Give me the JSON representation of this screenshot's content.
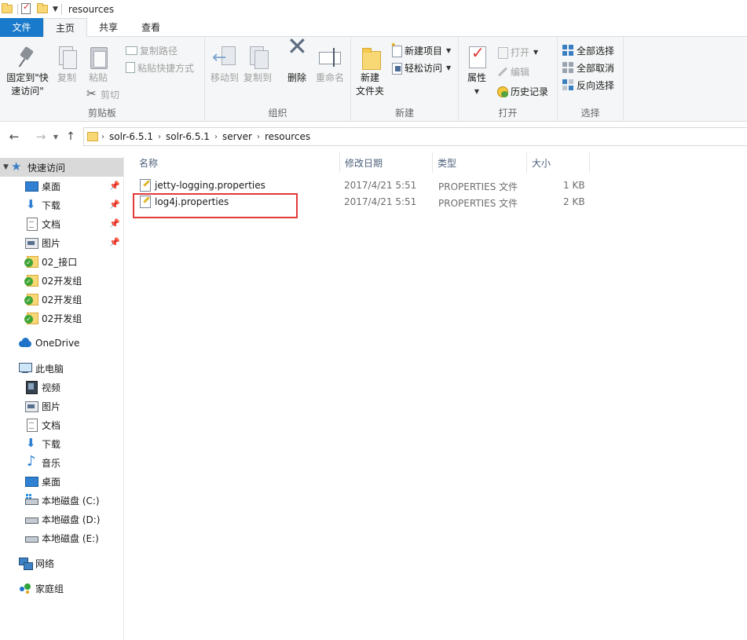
{
  "window": {
    "title": "resources"
  },
  "tabs": {
    "file": "文件",
    "home": "主页",
    "share": "共享",
    "view": "查看"
  },
  "ribbon": {
    "clipboard": {
      "pin_label": "固定到\"快速访问\"",
      "pin_line1": "固定到\"快",
      "pin_line2": "速访问\"",
      "copy": "复制",
      "paste": "粘贴",
      "copy_path": "复制路径",
      "paste_shortcut": "粘贴快捷方式",
      "cut": "剪切",
      "group": "剪贴板"
    },
    "organize": {
      "move_to": "移动到",
      "copy_to": "复制到",
      "delete": "删除",
      "rename": "重命名",
      "group": "组织"
    },
    "new": {
      "new_folder_line1": "新建",
      "new_folder_line2": "文件夹",
      "new_item": "新建项目",
      "easy_access": "轻松访问",
      "group": "新建"
    },
    "open": {
      "properties": "属性",
      "open": "打开",
      "edit": "编辑",
      "history": "历史记录",
      "group": "打开"
    },
    "select": {
      "select_all": "全部选择",
      "select_none": "全部取消",
      "invert": "反向选择",
      "group": "选择"
    }
  },
  "address": {
    "crumbs": [
      "solr-6.5.1",
      "solr-6.5.1",
      "server",
      "resources"
    ]
  },
  "sidebar": {
    "quick_access": "快速访问",
    "quick_items": [
      {
        "label": "桌面",
        "icon": "desktop-icon",
        "pinned": true
      },
      {
        "label": "下载",
        "icon": "download-icon",
        "pinned": true
      },
      {
        "label": "文档",
        "icon": "document-icon",
        "pinned": true
      },
      {
        "label": "图片",
        "icon": "picture-icon",
        "pinned": true
      },
      {
        "label": "02_接口",
        "icon": "sync-folder-icon",
        "pinned": false
      },
      {
        "label": "02开发组",
        "icon": "sync-folder-icon",
        "pinned": false
      },
      {
        "label": "02开发组",
        "icon": "sync-folder-icon",
        "pinned": false
      },
      {
        "label": "02开发组",
        "icon": "sync-folder-icon",
        "pinned": false
      }
    ],
    "onedrive": "OneDrive",
    "this_pc": "此电脑",
    "pc_items": [
      {
        "label": "视频",
        "icon": "video-icon"
      },
      {
        "label": "图片",
        "icon": "picture-icon"
      },
      {
        "label": "文档",
        "icon": "document-icon"
      },
      {
        "label": "下载",
        "icon": "download-icon"
      },
      {
        "label": "音乐",
        "icon": "music-icon"
      },
      {
        "label": "桌面",
        "icon": "desktop-icon"
      },
      {
        "label": "本地磁盘 (C:)",
        "icon": "drive-c-icon"
      },
      {
        "label": "本地磁盘 (D:)",
        "icon": "drive-icon"
      },
      {
        "label": "本地磁盘 (E:)",
        "icon": "drive-icon"
      }
    ],
    "network": "网络",
    "homegroup": "家庭组"
  },
  "filelist": {
    "columns": {
      "name": "名称",
      "modified": "修改日期",
      "type": "类型",
      "size": "大小"
    },
    "rows": [
      {
        "name": "jetty-logging.properties",
        "modified": "2017/4/21 5:51",
        "type": "PROPERTIES 文件",
        "size": "1 KB"
      },
      {
        "name": "log4j.properties",
        "modified": "2017/4/21 5:51",
        "type": "PROPERTIES 文件",
        "size": "2 KB"
      }
    ]
  },
  "colors": {
    "accent": "#1979ca",
    "highlight": "#e23a3a"
  }
}
